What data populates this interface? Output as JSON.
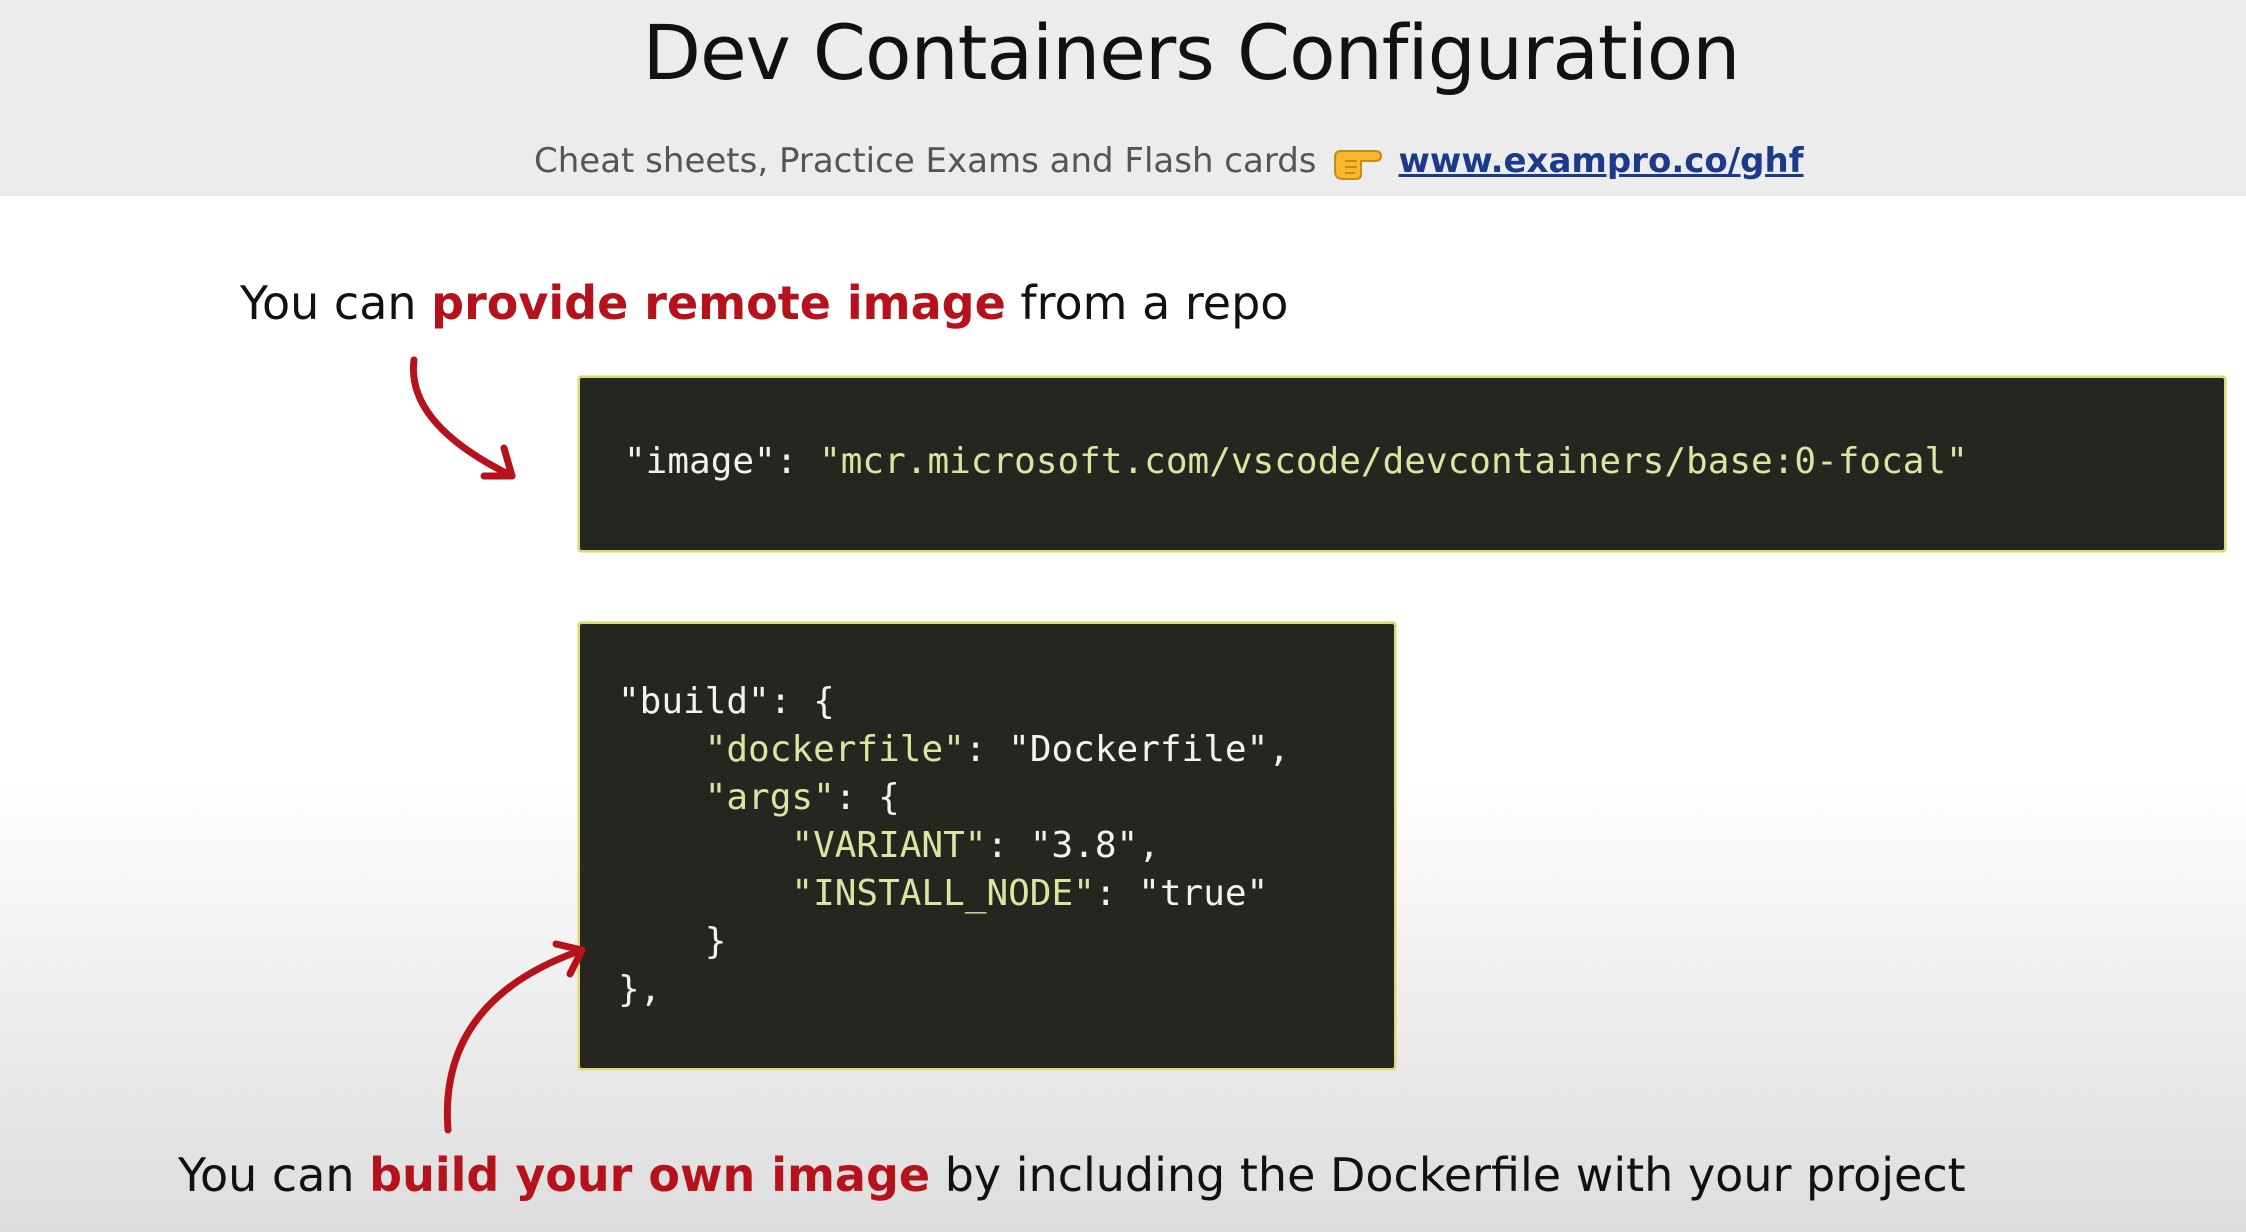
{
  "header": {
    "title": "Dev Containers Configuration",
    "promo_text": "Cheat sheets, Practice Exams and Flash cards",
    "promo_icon": "pointing-hand-icon",
    "promo_link": "www.exampro.co/ghf"
  },
  "caption_1": {
    "prefix": "You can ",
    "highlight": "provide remote image",
    "suffix": " from a repo"
  },
  "code_1": {
    "key": "\"image\"",
    "colon": ": ",
    "value": "\"mcr.microsoft.com/vscode/devcontainers/base:0-focal\""
  },
  "code_2": {
    "build_key": "\"build\"",
    "dockerfile_key": "\"dockerfile\"",
    "dockerfile_value": "\"Dockerfile\"",
    "args_key": "\"args\"",
    "variant_key": "\"VARIANT\"",
    "variant_value": "\"3.8\"",
    "install_node_key": "\"INSTALL_NODE\"",
    "install_node_value": "\"true\""
  },
  "caption_2": {
    "prefix": "You can ",
    "highlight": "build your own image",
    "suffix": " by including the Dockerfile with your project"
  },
  "colors": {
    "highlight": "#b5121b",
    "code_background": "#262620",
    "code_key": "#d8e6a2",
    "link": "#1b3a8c"
  }
}
